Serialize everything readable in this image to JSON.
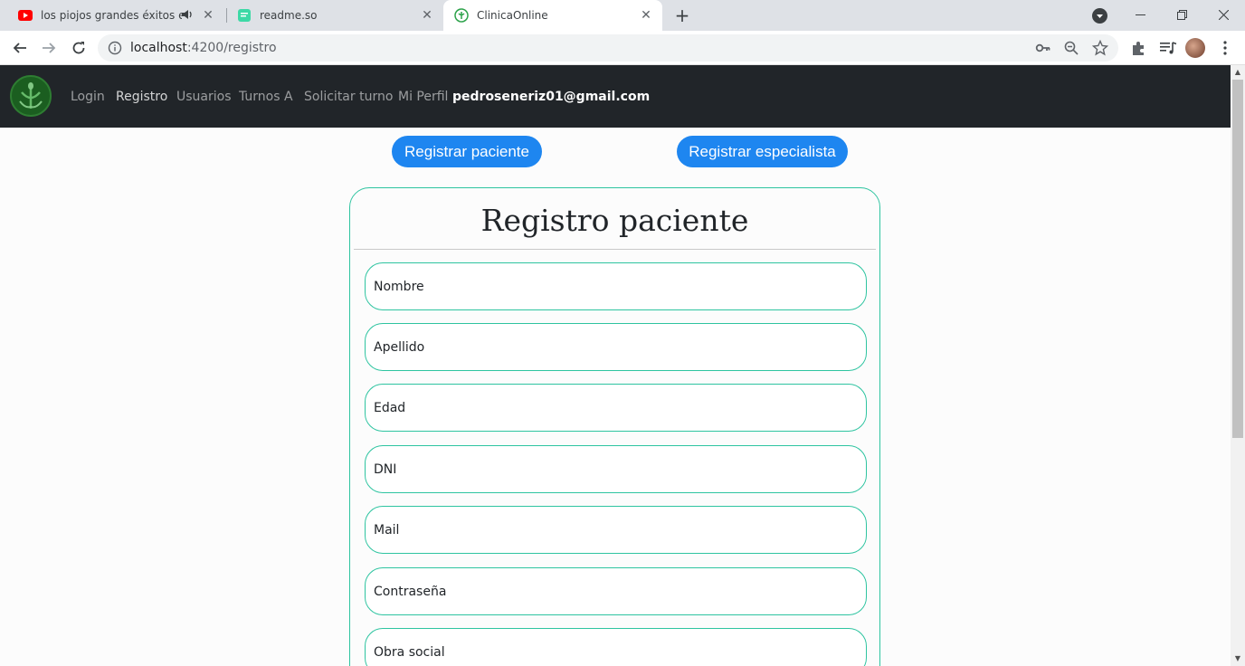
{
  "browser": {
    "tabs": [
      {
        "title": "los piojos grandes éxitos en",
        "favicon": "youtube-icon",
        "audio": true
      },
      {
        "title": "readme.so",
        "favicon": "readme-icon"
      },
      {
        "title": "ClinicaOnline",
        "favicon": "clinica-logo-icon",
        "active": true
      }
    ],
    "url_host": "localhost",
    "url_path": ":4200/registro"
  },
  "navbar": {
    "links": [
      "Login",
      "Registro",
      "Usuarios",
      "Turnos A",
      "Solicitar turno",
      "Mi Perfil"
    ],
    "active_link": "Registro",
    "user_email": "pedroseneriz01@gmail.com"
  },
  "page": {
    "btn_paciente": "Registrar paciente",
    "btn_especialista": "Registrar especialista",
    "form_title": "Registro paciente",
    "fields": [
      {
        "placeholder": "Nombre"
      },
      {
        "placeholder": "Apellido"
      },
      {
        "placeholder": "Edad"
      },
      {
        "placeholder": "DNI"
      },
      {
        "placeholder": "Mail"
      },
      {
        "placeholder": "Contraseña"
      },
      {
        "placeholder": "Obra social"
      }
    ]
  },
  "colors": {
    "navbar_bg": "#212529",
    "button_blue": "#1e86f0",
    "field_border": "#2ec4a0"
  }
}
